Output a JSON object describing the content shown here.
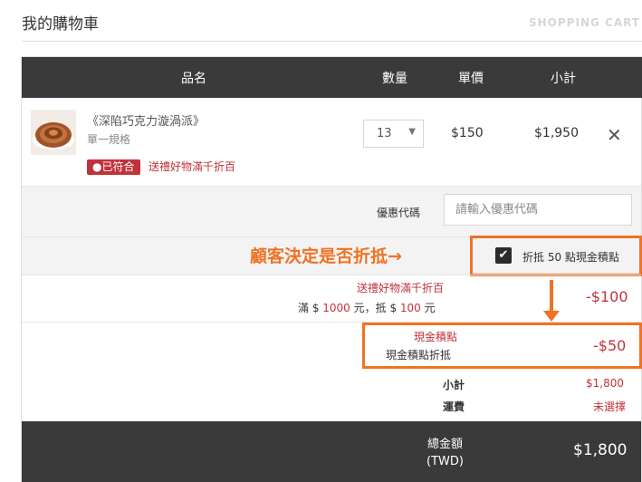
{
  "page": {
    "title": "我的購物車",
    "subtitle": "SHOPPING CART"
  },
  "table_header": {
    "col_name": "品名",
    "col_qty": "數量",
    "col_price": "單價",
    "col_subtotal": "小計"
  },
  "item": {
    "name": "《深陷巧克力漩渦派》",
    "spec": "單一規格",
    "badge": "已符合",
    "promo_link": "送禮好物滿千折百",
    "quantity": "13",
    "quantity_arrow": "▼",
    "price": "$150",
    "subtotal": "$1,950",
    "remove_glyph": "✕"
  },
  "coupon": {
    "label": "優惠代碼",
    "placeholder": "請輸入優惠代碼"
  },
  "points": {
    "annotation": "顧客決定是否折抵→",
    "checked": true,
    "check_glyph": "✔",
    "label": "折抵 50 點現金積點"
  },
  "discount": {
    "title": "送禮好物滿千折百",
    "detail_prefix": "滿 $ ",
    "detail_threshold": "1000",
    "detail_mid": " 元，抵 $ ",
    "detail_off": "100",
    "detail_suffix": " 元",
    "amount": "-$100"
  },
  "cash_points": {
    "title": "現金積點",
    "detail": "現金積點折抵",
    "amount": "-$50"
  },
  "summary": {
    "subtotal_label": "小計",
    "subtotal_value": "$1,800",
    "shipping_label": "運費",
    "shipping_value": "未選擇",
    "total_label_line1": "總金額",
    "total_label_line2": "(TWD)",
    "total_value": "$1,800"
  },
  "colors": {
    "header_bg": "#3a3a3a",
    "accent_red": "#c0323b",
    "annotation_orange": "#f07225"
  }
}
